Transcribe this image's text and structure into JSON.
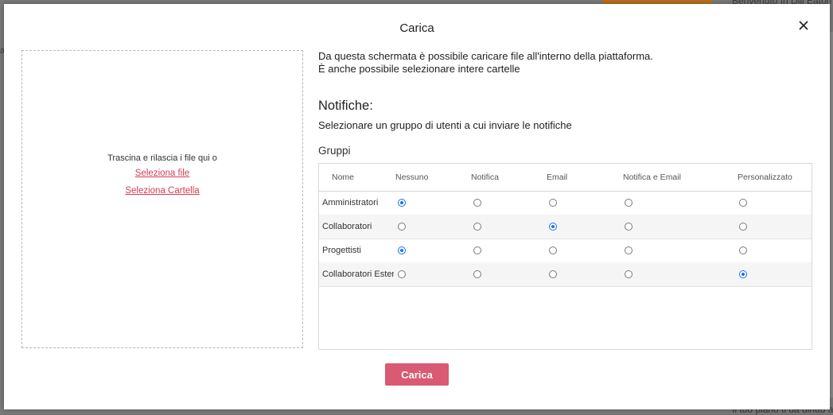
{
  "background": {
    "right_top_text": "Benvenuto In Dill Eaton",
    "right_bottom_text": "Il tuo piano ti da diritto a",
    "left_char": "a"
  },
  "modal": {
    "title": "Carica",
    "close_icon": "close-icon"
  },
  "dropzone": {
    "text": "Trascina e rilascia i file qui o",
    "select_file": "Seleziona file",
    "select_folder": "Seleziona Cartella"
  },
  "intro": {
    "line1": "Da questa schermata è possibile caricare file all'interno della piattaforma.",
    "line2": "È anche possibile selezionare intere cartelle"
  },
  "notifications": {
    "title": "Notifiche:",
    "subtitle": "Selezionare un gruppo di utenti a cui inviare le notifiche"
  },
  "groups": {
    "title": "Gruppi",
    "columns": [
      "Nome",
      "Nessuno",
      "Notifica",
      "Email",
      "Notifica e Email",
      "Personalizzato"
    ],
    "rows": [
      {
        "name": "Amministratori",
        "selected": 0
      },
      {
        "name": "Collaboratori",
        "selected": 2
      },
      {
        "name": "Progettisti",
        "selected": 0
      },
      {
        "name": "Collaboratori Esterni",
        "selected": 4
      }
    ]
  },
  "submit_label": "Carica",
  "colors": {
    "accent": "#d95a72",
    "link": "#d43c52",
    "radio_selected": "#1a73e8"
  }
}
